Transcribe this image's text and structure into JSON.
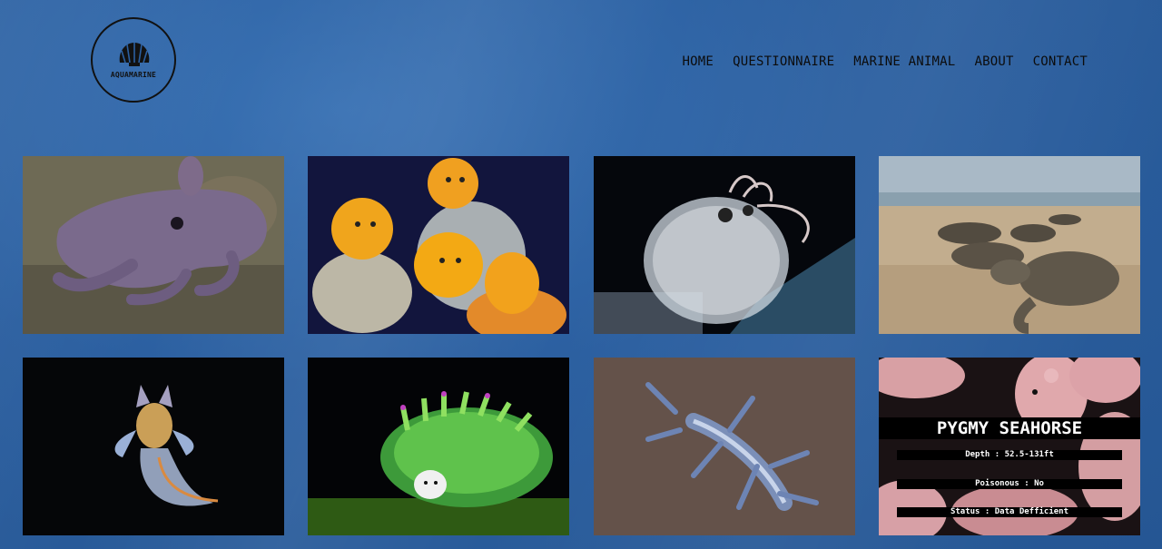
{
  "logo": {
    "text": "AQUAMARINE"
  },
  "nav": {
    "items": [
      "HOME",
      "QUESTIONNAIRE",
      "MARINE ANIMAL",
      "ABOUT",
      "CONTACT"
    ]
  },
  "cards": [
    {
      "name": "dumbo-octopus"
    },
    {
      "name": "yellow-frogfish"
    },
    {
      "name": "piglet-squid"
    },
    {
      "name": "sea-turtle-hatchlings"
    },
    {
      "name": "sea-angel"
    },
    {
      "name": "leaf-sheep"
    },
    {
      "name": "blue-dragon"
    },
    {
      "name": "pygmy-seahorse",
      "title": "PYGMY SEAHORSE",
      "depth": "Depth : 52.5-131ft",
      "poisonous": "Poisonous : No",
      "status": "Status : Data Defficient"
    }
  ]
}
